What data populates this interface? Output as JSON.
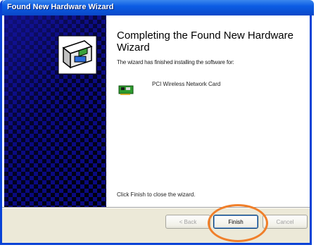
{
  "window": {
    "title": "Found New Hardware Wizard"
  },
  "main": {
    "heading": "Completing the Found New Hardware Wizard",
    "subtext": "The wizard has finished installing the software for:",
    "device_name": "PCI Wireless Network Card",
    "finish_hint": "Click Finish to close the wizard."
  },
  "buttons": {
    "back_label": "< Back",
    "finish_label": "Finish",
    "cancel_label": "Cancel"
  },
  "colors": {
    "titlebar": "#0b5ce4",
    "panel": "#0b0b88",
    "highlight": "#f07f2a"
  }
}
